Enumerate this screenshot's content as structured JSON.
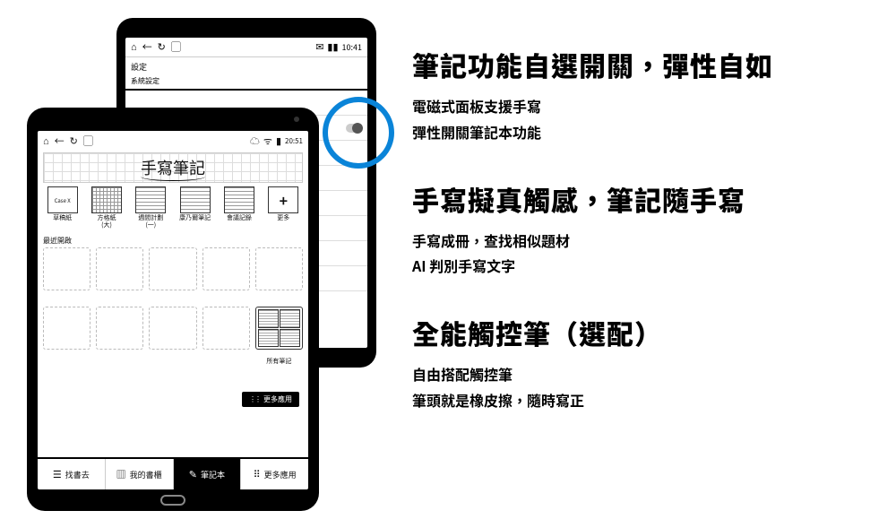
{
  "back_tablet": {
    "status_time": "10:41",
    "settings_title": "設定",
    "settings_section": "系統設定"
  },
  "front_tablet": {
    "status_time": "20:51",
    "handwritten_title": "手寫筆記",
    "templates": [
      {
        "label": "草稿紙",
        "thumb_text": "Case X",
        "style": "blank"
      },
      {
        "label": "方格紙\n(大)",
        "style": "grid"
      },
      {
        "label": "週間計劃\n(一)",
        "style": "lines"
      },
      {
        "label": "康乃爾筆記",
        "style": "lines"
      },
      {
        "label": "會議記錄",
        "style": "lines"
      },
      {
        "label": "更多",
        "style": "plus"
      }
    ],
    "recent_label": "最近開啟",
    "all_notes_caption": "所有筆記",
    "more_button": "更多應用",
    "nav": {
      "find": "找書去",
      "shelf": "我的書櫃",
      "notes": "筆記本",
      "apps": "更多應用"
    }
  },
  "marketing": [
    {
      "heading": "筆記功能自選開關，彈性自如",
      "lines": [
        "電磁式面板支援手寫",
        "彈性開關筆記本功能"
      ]
    },
    {
      "heading": "手寫擬真觸感，筆記隨手寫",
      "lines": [
        "手寫成冊，查找相似題材",
        "AI 判別手寫文字"
      ]
    },
    {
      "heading": "全能觸控筆（選配）",
      "lines": [
        "自由搭配觸控筆",
        "筆頭就是橡皮擦，隨時寫正"
      ]
    }
  ]
}
